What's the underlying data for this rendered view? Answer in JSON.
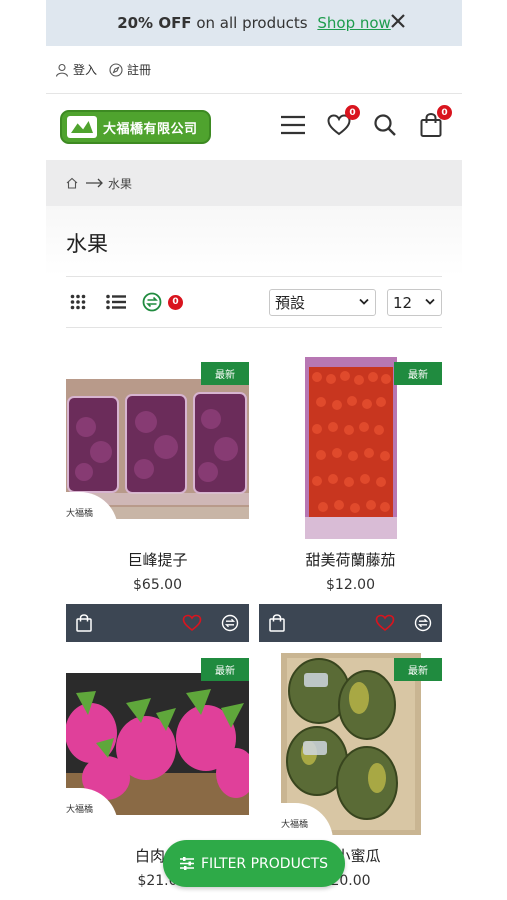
{
  "promo": {
    "bold": "20% OFF",
    "text": " on all products ",
    "link": "Shop now"
  },
  "account": {
    "login": "登入",
    "register": "註冊"
  },
  "header": {
    "logo_text": "大福橋有限公司",
    "wishlist_count": "0",
    "cart_count": "0",
    "icons": [
      "menu-icon",
      "heart-icon",
      "search-icon",
      "cart-bag-icon"
    ]
  },
  "breadcrumb": {
    "current": "水果"
  },
  "page": {
    "title": "水果"
  },
  "toolbar": {
    "compare_count": "0",
    "sort_value": "預設",
    "per_page_value": "12"
  },
  "products": [
    {
      "tag": "最新",
      "brand": "大福橋",
      "name": "巨峰提子",
      "price": "$65.00"
    },
    {
      "tag": "最新",
      "brand": "",
      "name": "甜美荷蘭藤茄",
      "price": "$12.00"
    },
    {
      "tag": "最新",
      "brand": "大福橋",
      "name": "白肉火",
      "price": "$21.0"
    },
    {
      "tag": "最新",
      "brand": "大福橋",
      "name": "仔小蜜瓜",
      "price": "20.00"
    }
  ],
  "filter_button": {
    "label": "FILTER PRODUCTS"
  },
  "colors": {
    "accent_green": "#208b3f",
    "badge_red": "#d9141e",
    "bar_dark": "#3c4653",
    "fab_green": "#2eaa48"
  }
}
